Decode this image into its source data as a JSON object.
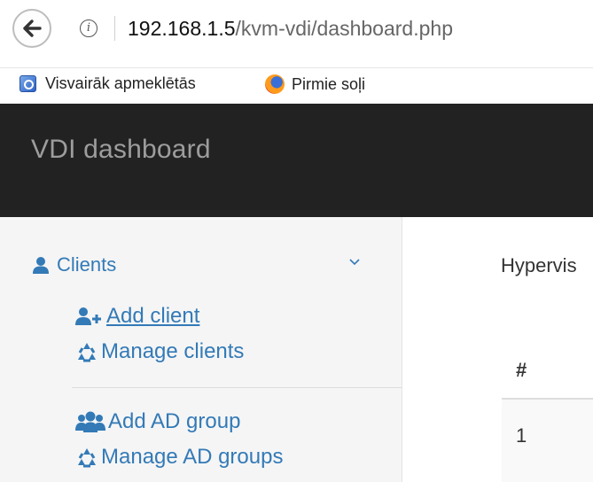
{
  "browser": {
    "url_host": "192.168.1.5",
    "url_path": "/kvm-vdi/dashboard.php",
    "bookmarks": [
      {
        "label": "Visvairāk apmeklētās",
        "icon": "page-icon"
      },
      {
        "label": "Pirmie soļi",
        "icon": "firefox-icon"
      }
    ]
  },
  "header": {
    "brand": "VDI dashboard"
  },
  "sidebar": {
    "section": {
      "label": "Clients",
      "icon": "user-icon",
      "expanded": true
    },
    "items": [
      {
        "label": "Add client",
        "icon": "user-plus-icon"
      },
      {
        "label": "Manage clients",
        "icon": "recycle-icon"
      },
      {
        "label": "Add AD group",
        "icon": "users-icon"
      },
      {
        "label": "Manage AD groups",
        "icon": "recycle-icon"
      }
    ]
  },
  "main": {
    "title": "Hypervis",
    "table": {
      "columns": [
        "#"
      ],
      "rows": [
        [
          "1"
        ]
      ]
    }
  },
  "colors": {
    "link": "#337ab7",
    "navbar": "#222222",
    "brand_text": "#9d9d9d",
    "sidebar_bg": "#f5f5f5"
  }
}
